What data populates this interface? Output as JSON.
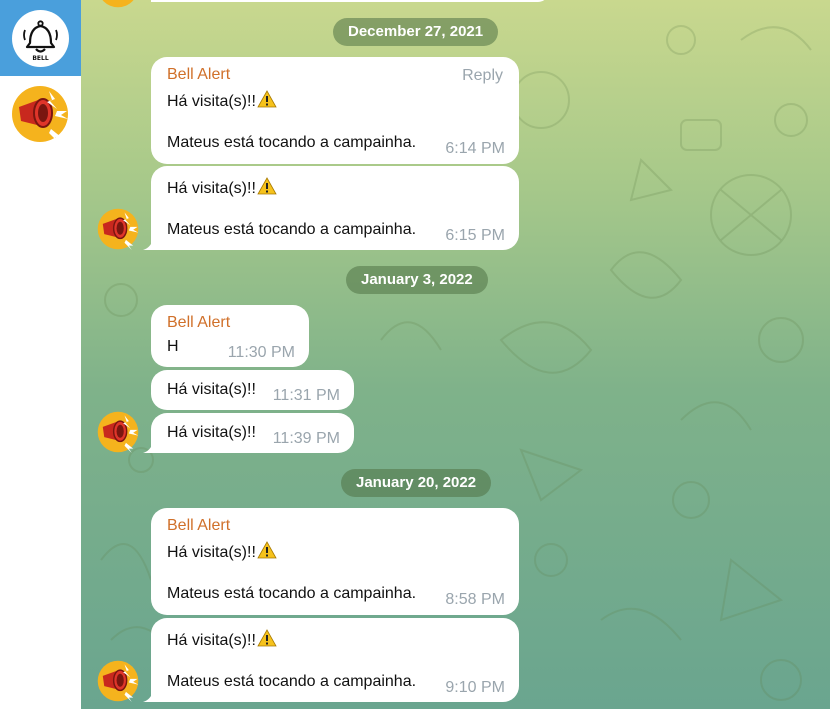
{
  "sidebar": {
    "bell_logo_text": "BELL",
    "chats": [
      {
        "icon": "megaphone-avatar-icon"
      }
    ]
  },
  "colors": {
    "sender": "#d0702a",
    "time": "#9aa5ad",
    "sidebar_active": "#4a9fdc",
    "date_pill": "#50734680"
  },
  "chat": {
    "dates": [
      {
        "label": "December 27, 2021"
      },
      {
        "label": "January 3, 2022"
      },
      {
        "label": "January 20, 2022"
      }
    ],
    "reply_label": "Reply",
    "messages": [
      {
        "sender": "Bell Alert",
        "line1": "Há visita(s)!!",
        "warning": "⚠",
        "line2": "Mateus está tocando a campainha.",
        "time": "6:14 PM"
      },
      {
        "line1": "Há visita(s)!!",
        "warning": "⚠",
        "line2": "Mateus está tocando a campainha.",
        "time": "6:15 PM"
      },
      {
        "sender": "Bell Alert",
        "line1": "H",
        "time": "11:30 PM"
      },
      {
        "line1": "Há visita(s)!!",
        "time": "11:31 PM"
      },
      {
        "line1": "Há visita(s)!!",
        "time": "11:39 PM"
      },
      {
        "sender": "Bell Alert",
        "line1": "Há visita(s)!!",
        "warning": "⚠",
        "line2": "Mateus está tocando a campainha.",
        "time": "8:58 PM"
      },
      {
        "line1": "Há visita(s)!!",
        "warning": "⚠",
        "line2": "Mateus está tocando a campainha.",
        "time": "9:10 PM"
      }
    ]
  }
}
